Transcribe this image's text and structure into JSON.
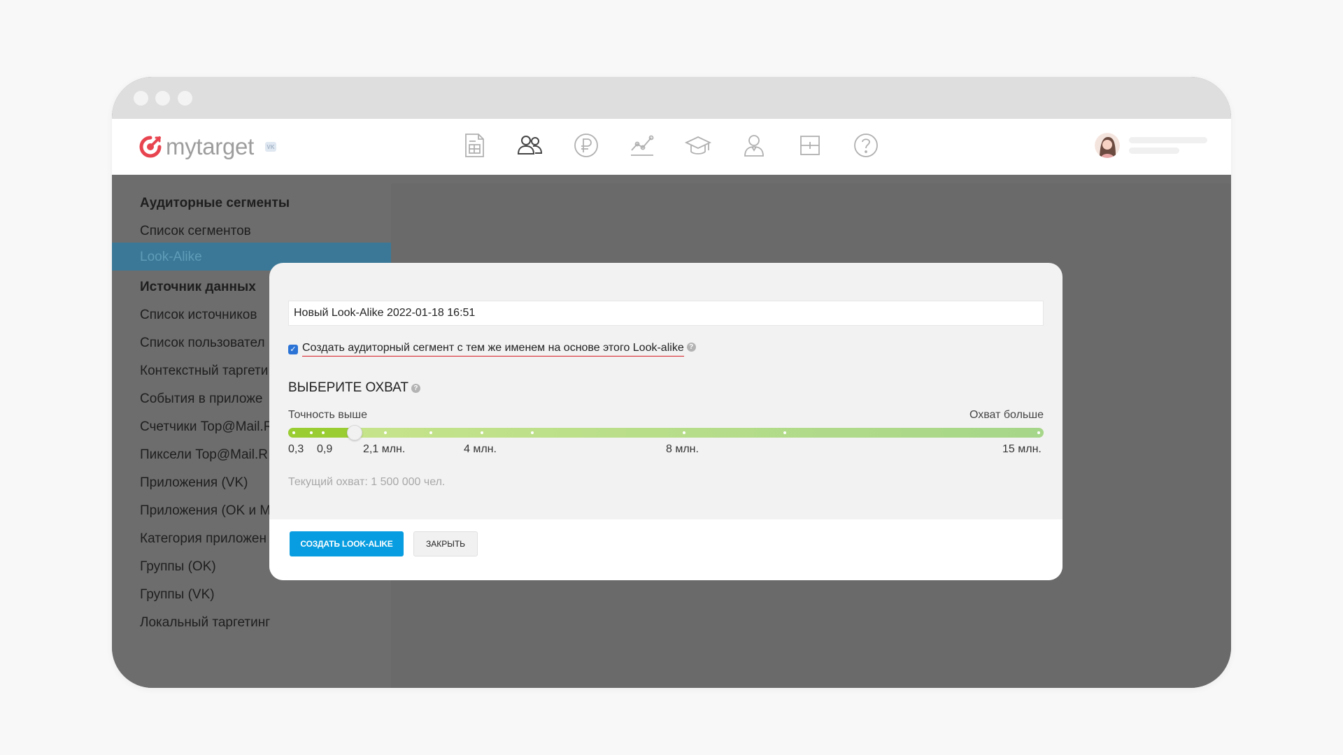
{
  "brand": {
    "logo_text": "mytarget",
    "badge": "VK",
    "accent": "#e8444f"
  },
  "nav": {
    "icons": [
      "campaigns-icon",
      "audiences-icon",
      "billing-icon",
      "statistics-icon",
      "education-icon",
      "profile-icon",
      "tools-icon",
      "help-icon"
    ],
    "active": "audiences-icon"
  },
  "sidebar": {
    "section1": "Аудиторные сегменты",
    "item_segments": "Список сегментов",
    "item_lookalike": "Look-Alike",
    "section2": "Источник данных",
    "items": [
      "Список источников",
      "Список пользовател",
      "Контекстный таргети",
      "События в приложе",
      "Счетчики Top@Mail.R",
      "Пиксели Top@Mail.R",
      "Приложения (VK)",
      "Приложения (OK и M",
      "Категория приложен",
      "Группы (OK)",
      "Группы (VK)",
      "Локальный таргетинг"
    ]
  },
  "modal": {
    "name_value": "Новый Look-Alike 2022-01-18 16:51",
    "checkbox_checked": true,
    "checkbox_label": "Создать аудиторный сегмент с тем же именем на основе этого Look-alike",
    "help_glyph": "?",
    "reach_title": "ВЫБЕРИТЕ ОХВАТ",
    "label_left": "Точность выше",
    "label_right": "Охват больше",
    "ticks": [
      "0,3",
      "0,9",
      "2,1 млн.",
      "4 млн.",
      "8 млн.",
      "15 млн."
    ],
    "slider_value": "1 500 000",
    "current_reach": "Текущий охват: 1 500 000 чел.",
    "create_button": "СОЗДАТЬ LOOK-ALIKE",
    "close_button": "ЗАКРЫТЬ"
  },
  "colors": {
    "primary_button": "#089de0",
    "active_sidebar": "#3b7897",
    "slider_fill": "#9acd32",
    "underline": "#d91f26"
  }
}
